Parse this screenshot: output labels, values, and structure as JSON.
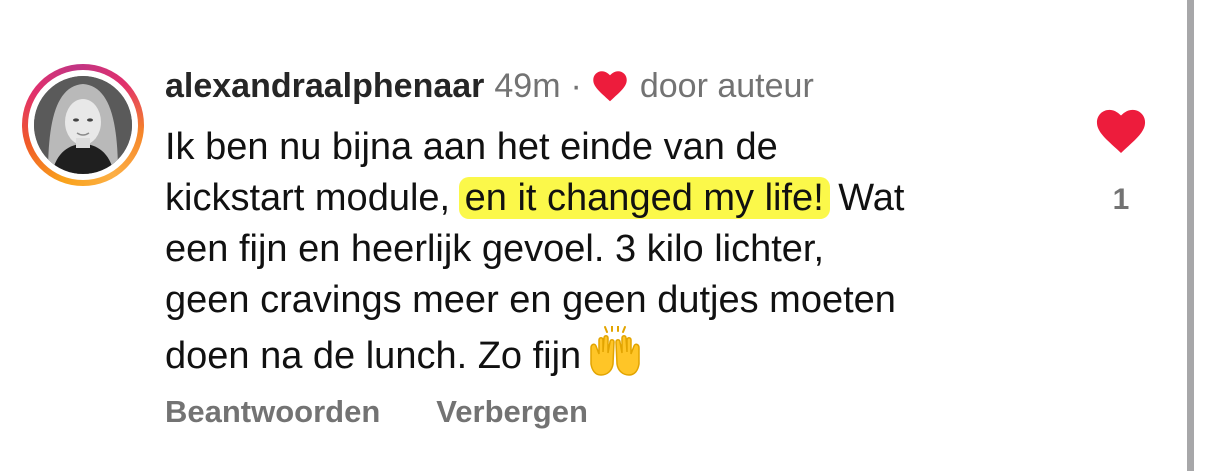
{
  "comment": {
    "username": "alexandraalphenaar",
    "time": "49m",
    "separator": "·",
    "liked_by_author_label": "door auteur",
    "text": {
      "line1": "Ik ben nu bijna aan het einde van de",
      "line2_prefix": "kickstart module, ",
      "line2_highlight": "en it changed my life!",
      "line2_suffix": " Wat",
      "line3": "een fijn en heerlijk gevoel. 3 kilo lichter,",
      "line4": "geen cravings meer en geen dutjes moeten",
      "line5": "doen na de lunch. Zo fijn"
    },
    "emoji": "raising-hands-emoji",
    "actions": {
      "reply_label": "Beantwoorden",
      "hide_label": "Verbergen"
    },
    "like_count": "1"
  },
  "colors": {
    "like_heart": "#ed1c3c",
    "highlight": "#fbf84a",
    "muted_text": "#737373",
    "username_text": "#262626",
    "body_text": "#111111"
  },
  "icons": {
    "author_like": "heart-icon",
    "like_button": "heart-icon"
  }
}
